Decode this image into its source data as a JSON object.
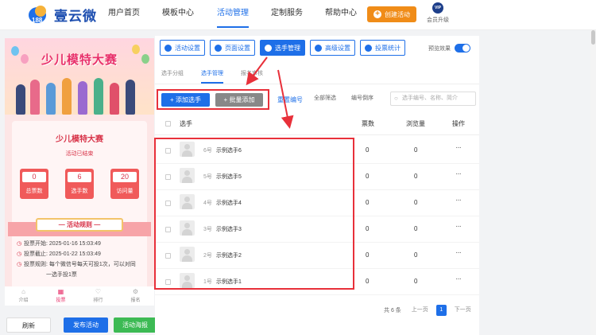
{
  "logo": {
    "text": "壹云微",
    "mark_number": "188"
  },
  "nav": {
    "items": [
      {
        "label": "用户首页"
      },
      {
        "label": "模板中心"
      },
      {
        "label": "活动管理"
      },
      {
        "label": "定制服务"
      },
      {
        "label": "帮助中心"
      }
    ],
    "active": "活动管理",
    "create_label": "创建活动",
    "vip_badge": "VIP",
    "vip_label": "会员升级"
  },
  "preview": {
    "banner_title": "少儿模特大赛",
    "card_title": "少儿模特大赛",
    "status": "活动已结束",
    "stats": [
      {
        "value": "0",
        "label": "总票数"
      },
      {
        "value": "6",
        "label": "选手数"
      },
      {
        "value": "20",
        "label": "访问量"
      }
    ],
    "rules_title": "— 活动规则 —",
    "rules": [
      {
        "label": "投票开始:",
        "value": "2025-01-16 15:03:49"
      },
      {
        "label": "投票截止:",
        "value": "2025-01-22 15:03:49"
      },
      {
        "label": "投票规则:",
        "value": "每个微信号每天可投1次，可以对同",
        "sub": "一选手投1票"
      }
    ],
    "tabs": [
      {
        "icon": "⌂",
        "label": "介绍"
      },
      {
        "icon": "▦",
        "label": "投票"
      },
      {
        "icon": "♡",
        "label": "排行"
      },
      {
        "icon": "⚙",
        "label": "报名"
      }
    ]
  },
  "bottom_buttons": {
    "refresh": "刷新",
    "publish": "发布活动",
    "poster": "活动海报"
  },
  "toolbar": {
    "buttons": [
      {
        "label": "活动设置"
      },
      {
        "label": "页面设置"
      },
      {
        "label": "选手管理"
      },
      {
        "label": "高级设置"
      },
      {
        "label": "投票统计"
      }
    ],
    "active": "选手管理",
    "preview_label": "预览效果"
  },
  "subtabs": [
    "选手分组",
    "选手管理",
    "报名审核"
  ],
  "actions": {
    "add": "+ 添加选手",
    "batch": "+ 批量添加",
    "order": "重置编号",
    "filter_all": "全部筛选",
    "filter_order": "编号倒序",
    "search_placeholder": "选手编号、名称、简介"
  },
  "table": {
    "headers": {
      "contestant": "选手",
      "votes": "票数",
      "views": "浏览量",
      "ops": "操作"
    },
    "rows": [
      {
        "no": "6号",
        "name": "示例选手6",
        "votes": "0",
        "views": "0"
      },
      {
        "no": "5号",
        "name": "示例选手5",
        "votes": "0",
        "views": "0"
      },
      {
        "no": "4号",
        "name": "示例选手4",
        "votes": "0",
        "views": "0"
      },
      {
        "no": "3号",
        "name": "示例选手3",
        "votes": "0",
        "views": "0"
      },
      {
        "no": "2号",
        "name": "示例选手2",
        "votes": "0",
        "views": "0"
      },
      {
        "no": "1号",
        "name": "示例选手1",
        "votes": "0",
        "views": "0"
      }
    ],
    "more_glyph": "···"
  },
  "pager": {
    "total": "共 6 条",
    "prev": "上一页",
    "current": "1",
    "next": "下一页"
  },
  "colors": {
    "primary": "#1e6fe8",
    "accent": "#f08c18",
    "highlight": "#e8303a",
    "success": "#3cba54"
  }
}
